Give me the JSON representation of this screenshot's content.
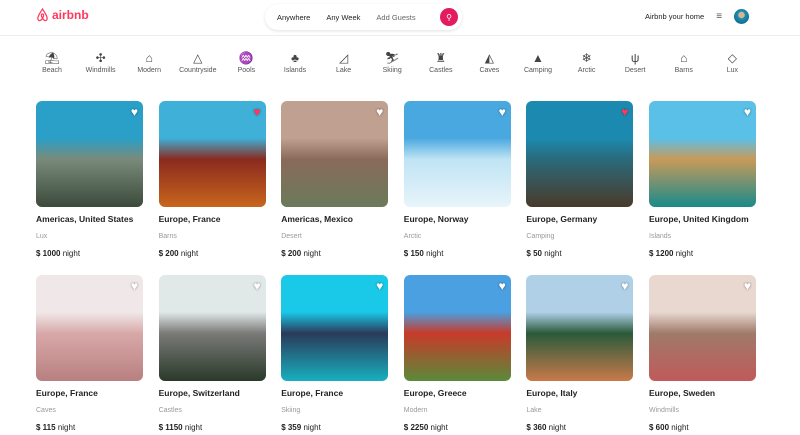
{
  "header": {
    "logo": "airbnb",
    "search": {
      "where": "Anywhere",
      "when": "Any Week",
      "guests": "Add Guests"
    },
    "host_link": "Airbnb your home"
  },
  "categories": [
    {
      "label": "Beach",
      "icon": "⛱"
    },
    {
      "label": "Windmills",
      "icon": "✣"
    },
    {
      "label": "Modern",
      "icon": "⌂"
    },
    {
      "label": "Countryside",
      "icon": "△"
    },
    {
      "label": "Pools",
      "icon": "♒"
    },
    {
      "label": "Islands",
      "icon": "♣"
    },
    {
      "label": "Lake",
      "icon": "◿"
    },
    {
      "label": "Skiing",
      "icon": "⛷"
    },
    {
      "label": "Castles",
      "icon": "♜"
    },
    {
      "label": "Caves",
      "icon": "◭"
    },
    {
      "label": "Camping",
      "icon": "▲"
    },
    {
      "label": "Arctic",
      "icon": "❄"
    },
    {
      "label": "Desert",
      "icon": "ψ"
    },
    {
      "label": "Barns",
      "icon": "⌂"
    },
    {
      "label": "Lux",
      "icon": "◇"
    }
  ],
  "price_unit": "night",
  "listings": [
    {
      "title": "Americas, United States",
      "category": "Lux",
      "price": "$ 1000",
      "favorite": false,
      "colors": [
        "#2aa0c8",
        "#7a8a7a",
        "#3b4a3a"
      ]
    },
    {
      "title": "Europe, France",
      "category": "Barns",
      "price": "$ 200",
      "favorite": true,
      "colors": [
        "#3fb0d8",
        "#8a2a1e",
        "#c8651e"
      ]
    },
    {
      "title": "Americas, Mexico",
      "category": "Desert",
      "price": "$ 200",
      "favorite": false,
      "colors": [
        "#c0a090",
        "#8a6a5a",
        "#6a7a5a"
      ]
    },
    {
      "title": "Europe, Norway",
      "category": "Arctic",
      "price": "$ 150",
      "favorite": false,
      "colors": [
        "#4aa8e0",
        "#bfe4f4",
        "#e8f4fa"
      ]
    },
    {
      "title": "Europe, Germany",
      "category": "Camping",
      "price": "$ 50",
      "favorite": true,
      "colors": [
        "#1c8ab0",
        "#2a6a7a",
        "#4a3a2a"
      ]
    },
    {
      "title": "Europe, United Kingdom",
      "category": "Islands",
      "price": "$ 1200",
      "favorite": false,
      "colors": [
        "#5ac0e8",
        "#c89a5a",
        "#1a8a8a"
      ]
    },
    {
      "title": "Europe, France",
      "category": "Caves",
      "price": "$ 115",
      "favorite": false,
      "colors": [
        "#f0e8e8",
        "#d8a8a8",
        "#b88080"
      ]
    },
    {
      "title": "Europe, Switzerland",
      "category": "Castles",
      "price": "$ 1150",
      "favorite": false,
      "colors": [
        "#e0e8e8",
        "#7a7a78",
        "#2a3a2a"
      ]
    },
    {
      "title": "Europe, France",
      "category": "Skiing",
      "price": "$ 359",
      "favorite": false,
      "colors": [
        "#1ac8e8",
        "#2a3a5a",
        "#18b0c0"
      ]
    },
    {
      "title": "Europe, Greece",
      "category": "Modern",
      "price": "$ 2250",
      "favorite": false,
      "colors": [
        "#4aa0e0",
        "#c83a2a",
        "#5a8a3a"
      ]
    },
    {
      "title": "Europe, Italy",
      "category": "Lake",
      "price": "$ 360",
      "favorite": false,
      "colors": [
        "#b0d0e8",
        "#2a5a3a",
        "#c87a4a"
      ]
    },
    {
      "title": "Europe, Sweden",
      "category": "Windmills",
      "price": "$ 600",
      "favorite": false,
      "colors": [
        "#e8d8d0",
        "#a07a6a",
        "#c05a5a"
      ]
    }
  ]
}
